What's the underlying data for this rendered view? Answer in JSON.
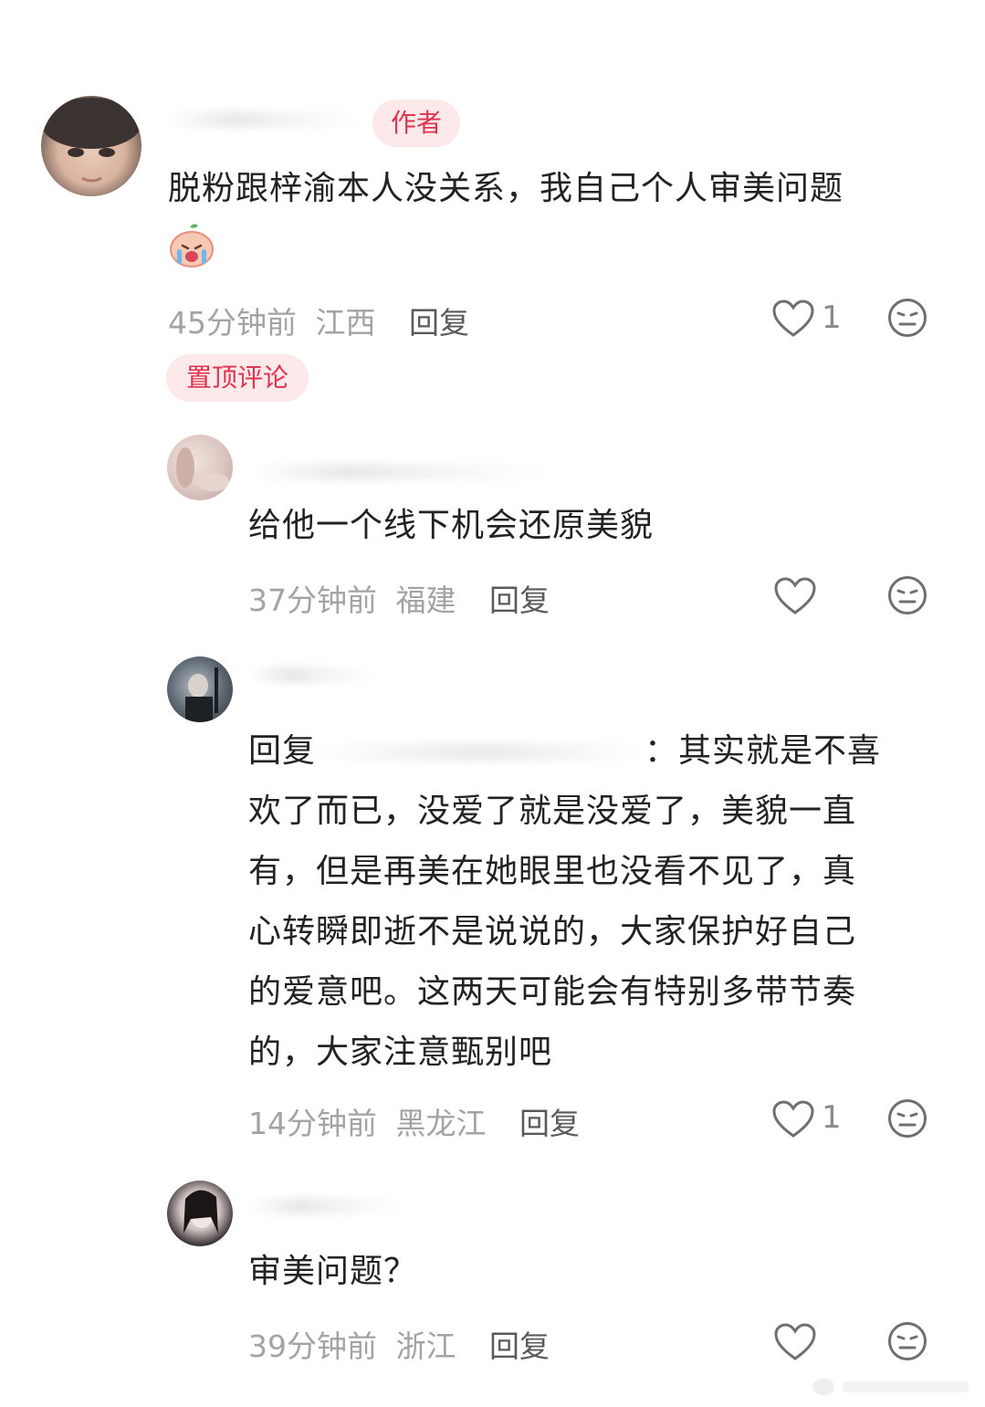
{
  "comments": [
    {
      "badge": "作者",
      "text_line1": "脱粉跟梓渝本人没关系，我自己个人审美问题",
      "time": "45分钟前",
      "location": "江西",
      "reply_label": "回复",
      "likes": "1",
      "pinned_label": "置顶评论"
    },
    {
      "text": "给他一个线下机会还原美貌",
      "time": "37分钟前",
      "location": "福建",
      "reply_label": "回复"
    },
    {
      "reply_prefix": "回复",
      "lines": [
        "：其实就是不喜",
        "欢了而已，没爱了就是没爱了，美貌一直",
        "有，但是再美在她眼里也没看不见了，真",
        "心转瞬即逝不是说说的，大家保护好自己",
        "的爱意吧。这两天可能会有特别多带节奏",
        "的，大家注意甄别吧"
      ],
      "time": "14分钟前",
      "location": "黑龙江",
      "reply_label": "回复",
      "likes": "1"
    },
    {
      "text": "审美问题？",
      "time": "39分钟前",
      "location": "浙江",
      "reply_label": "回复"
    }
  ],
  "icons": {
    "like": "heart-outline-icon",
    "dislike": "neutral-face-icon",
    "emoji": "crying-peach-emoji-icon"
  },
  "colors": {
    "accent": "#e0334f",
    "badge_bg": "#fde8ea",
    "meta_gray": "#a3a3a3"
  }
}
